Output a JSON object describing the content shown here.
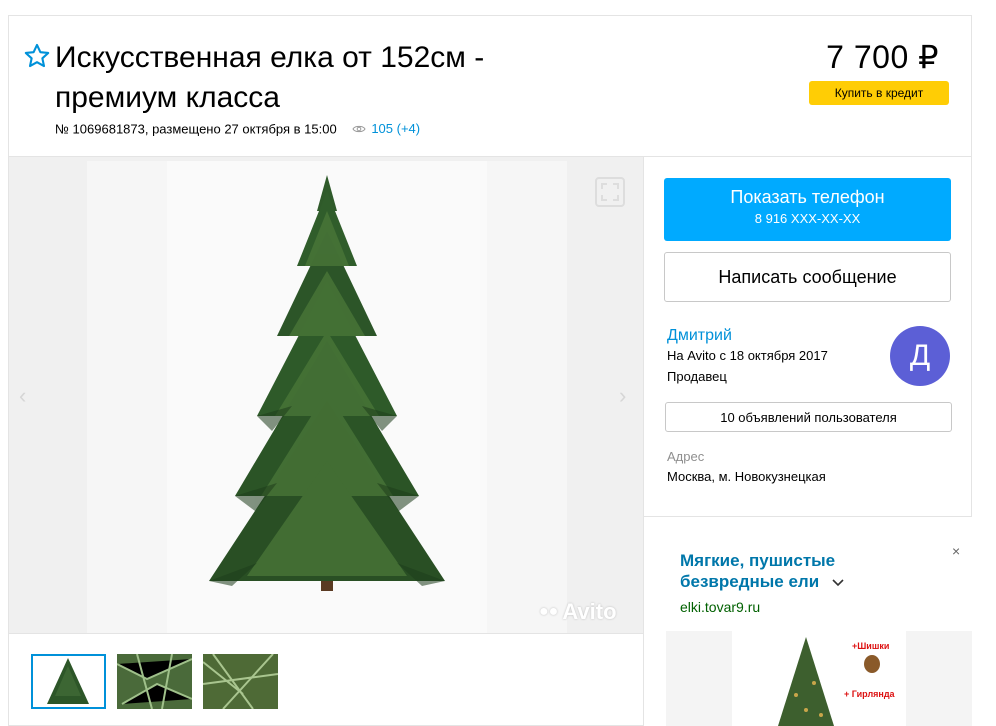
{
  "header": {
    "favorite_icon": "star-outline-icon",
    "title": "Искусственная елка от 152см - премиум класса",
    "meta": "№ 1069681873, размещено 27 октября в 15:00",
    "views": "105 (+4)",
    "price": "7 700 ₽",
    "credit_label": "Купить в кредит"
  },
  "gallery": {
    "watermark": "Avito",
    "prev_label": "‹",
    "next_label": "›"
  },
  "contact": {
    "phone_label": "Показать телефон",
    "phone_number": "8 916 XXX-XX-XX",
    "message_label": "Написать сообщение"
  },
  "seller": {
    "name": "Дмитрий",
    "since": "На Avito с 18 октября 2017",
    "role": "Продавец",
    "avatar_letter": "Д",
    "listings_label": "10 объявлений пользователя"
  },
  "address": {
    "label": "Адрес",
    "value": "Москва, м. Новокузнецкая"
  },
  "ad": {
    "title": "Мягкие, пушистые безвредные ели",
    "url": "elki.tovar9.ru",
    "close_label": "×",
    "tag_top": "+Шишки",
    "tag_bottom": "+ Гирлянда"
  },
  "colors": {
    "accent_blue": "#00aaff",
    "link_blue": "#0091d9",
    "credit_yellow": "#ffcd05",
    "avatar_purple": "#5c5fd6"
  }
}
